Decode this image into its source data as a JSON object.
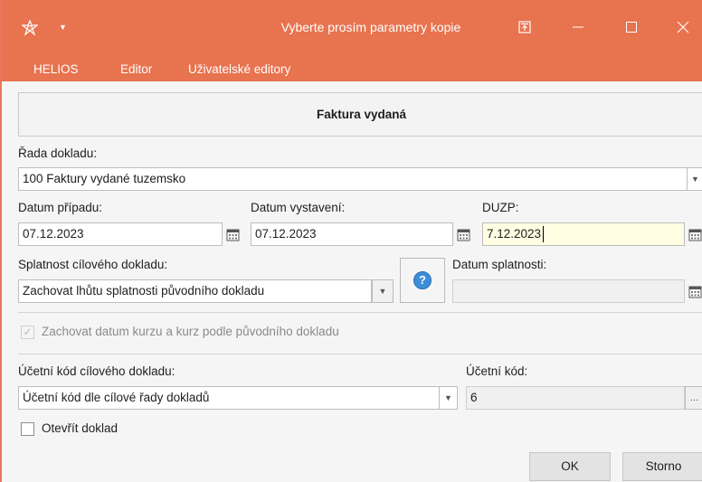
{
  "window": {
    "title": "Vyberte prosím parametry kopie"
  },
  "menu": {
    "items": [
      "HELIOS",
      "Editor",
      "Uživatelské editory"
    ]
  },
  "header": {
    "title": "Faktura vydaná"
  },
  "rada": {
    "label": "Řada dokladu:",
    "value": "100 Faktury vydané tuzemsko"
  },
  "datum_pripadu": {
    "label": "Datum případu:",
    "value": "07.12.2023"
  },
  "datum_vystaveni": {
    "label": "Datum vystavení:",
    "value": "07.12.2023"
  },
  "duzp": {
    "label": "DUZP:",
    "value": "7.12.2023"
  },
  "splatnost": {
    "label": "Splatnost cílového dokladu:",
    "value": "Zachovat lhůtu splatnosti původního dokladu"
  },
  "help": {
    "glyph": "?"
  },
  "datum_splatnosti": {
    "label": "Datum splatnosti:",
    "value": ""
  },
  "kurz": {
    "label": "Zachovat datum kurzu a kurz podle původního dokladu",
    "checked": true,
    "enabled": false
  },
  "ucetni_kod_cil": {
    "label": "Účetní kód cílového dokladu:",
    "value": "Účetní kód dle cílové řady dokladů"
  },
  "ucetni_kod": {
    "label": "Účetní kód:",
    "value": "6",
    "button": "..."
  },
  "otevrit": {
    "label": "Otevřít doklad",
    "checked": false
  },
  "buttons": {
    "ok": "OK",
    "cancel": "Storno"
  },
  "colors": {
    "accent": "#e8734f",
    "active_field": "#fffde2",
    "help_icon": "#3d8ed6"
  }
}
